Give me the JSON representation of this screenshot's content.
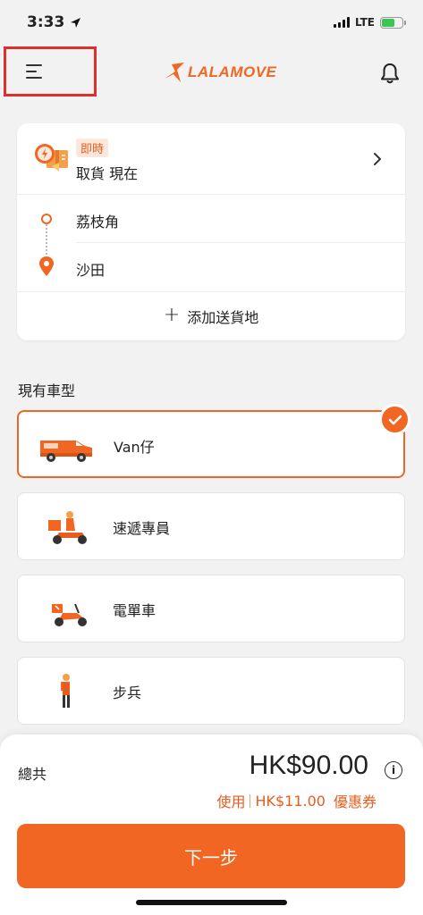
{
  "status_bar": {
    "time": "3:33",
    "network": "LTE"
  },
  "header": {
    "logo_text": "LALAMOVE"
  },
  "route": {
    "time_badge": "即時",
    "time_label": "取貨 現在",
    "stops": [
      "荔枝角",
      "沙田"
    ],
    "add_stop_label": "添加送貨地"
  },
  "vehicles": {
    "title": "現有車型",
    "items": [
      {
        "name": "Van仔",
        "selected": true
      },
      {
        "name": "速遞專員",
        "selected": false
      },
      {
        "name": "電單車",
        "selected": false
      },
      {
        "name": "步兵",
        "selected": false
      }
    ]
  },
  "checkout": {
    "total_label": "總共",
    "price": "HK$90.00",
    "coupon_prefix": "使用",
    "coupon_amount": "HK$11.00",
    "coupon_suffix": "優惠券",
    "next_label": "下一步"
  },
  "colors": {
    "accent": "#f16622",
    "highlight_box": "#e0302a",
    "background": "#f2f2f2"
  }
}
